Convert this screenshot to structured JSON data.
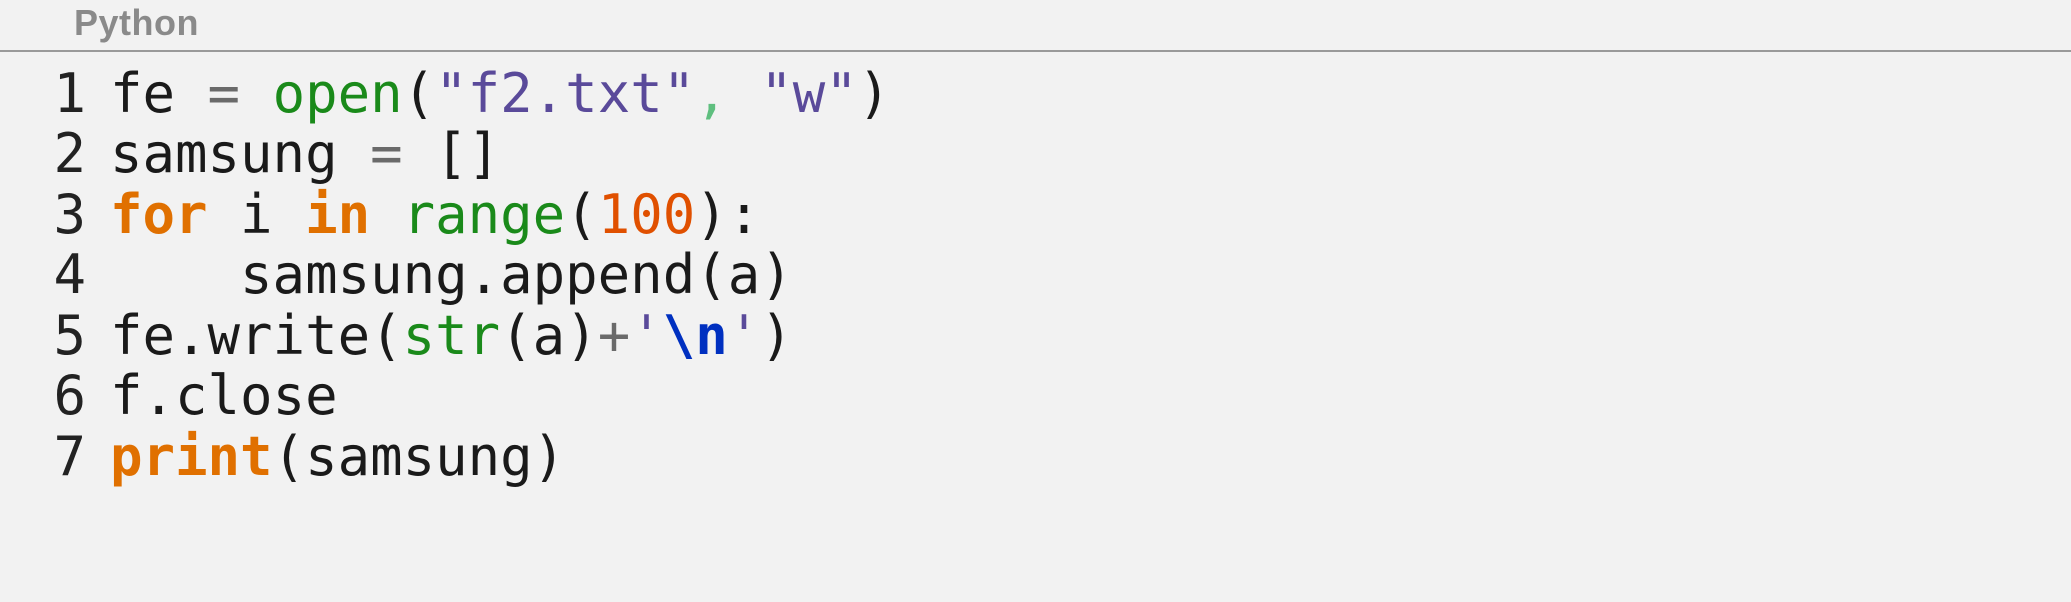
{
  "language_label": "Python",
  "lines": [
    {
      "num": "1",
      "tokens": [
        {
          "t": "fe ",
          "c": ""
        },
        {
          "t": "=",
          "c": "tok-op"
        },
        {
          "t": " ",
          "c": ""
        },
        {
          "t": "open",
          "c": "tok-builtin"
        },
        {
          "t": "(",
          "c": "tok-punct"
        },
        {
          "t": "\"f2.txt\"",
          "c": "tok-string"
        },
        {
          "t": ",",
          "c": "tok-comma"
        },
        {
          "t": " ",
          "c": ""
        },
        {
          "t": "\"w\"",
          "c": "tok-string"
        },
        {
          "t": ")",
          "c": "tok-punct"
        }
      ]
    },
    {
      "num": "2",
      "tokens": [
        {
          "t": "samsung ",
          "c": ""
        },
        {
          "t": "=",
          "c": "tok-op"
        },
        {
          "t": " []",
          "c": "tok-punct"
        }
      ]
    },
    {
      "num": "3",
      "tokens": [
        {
          "t": "for",
          "c": "tok-keyword"
        },
        {
          "t": " i ",
          "c": ""
        },
        {
          "t": "in",
          "c": "tok-keyword"
        },
        {
          "t": " ",
          "c": ""
        },
        {
          "t": "range",
          "c": "tok-builtin"
        },
        {
          "t": "(",
          "c": "tok-punct"
        },
        {
          "t": "100",
          "c": "tok-number"
        },
        {
          "t": "):",
          "c": "tok-punct"
        }
      ]
    },
    {
      "num": "4",
      "tokens": [
        {
          "t": "    samsung",
          "c": ""
        },
        {
          "t": ".",
          "c": "tok-punct"
        },
        {
          "t": "append",
          "c": ""
        },
        {
          "t": "(a)",
          "c": "tok-punct"
        }
      ]
    },
    {
      "num": "5",
      "tokens": [
        {
          "t": "fe",
          "c": ""
        },
        {
          "t": ".",
          "c": "tok-punct"
        },
        {
          "t": "write",
          "c": ""
        },
        {
          "t": "(",
          "c": "tok-punct"
        },
        {
          "t": "str",
          "c": "tok-builtin"
        },
        {
          "t": "(a)",
          "c": "tok-punct"
        },
        {
          "t": "+",
          "c": "tok-op"
        },
        {
          "t": "'",
          "c": "tok-string"
        },
        {
          "t": "\\n",
          "c": "tok-escape"
        },
        {
          "t": "'",
          "c": "tok-string"
        },
        {
          "t": ")",
          "c": "tok-punct"
        }
      ]
    },
    {
      "num": "6",
      "tokens": [
        {
          "t": "f",
          "c": ""
        },
        {
          "t": ".",
          "c": "tok-punct"
        },
        {
          "t": "close",
          "c": ""
        }
      ]
    },
    {
      "num": "7",
      "tokens": [
        {
          "t": "print",
          "c": "tok-keyword"
        },
        {
          "t": "(samsung)",
          "c": "tok-punct"
        }
      ]
    }
  ]
}
